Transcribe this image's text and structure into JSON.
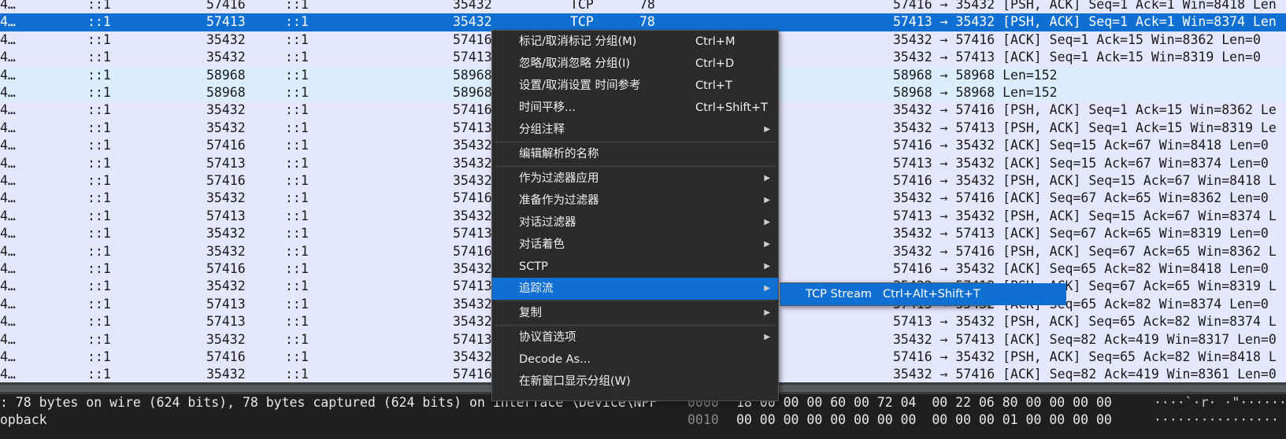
{
  "packet_rows": [
    {
      "no": "4…",
      "src": "::1",
      "sport": "57416",
      "dst": "::1",
      "dport": "35432",
      "proto": "TCP",
      "len": "78",
      "info": "57416 → 35432 [PSH, ACK] Seq=1 Ack=1 Win=8418 Len"
    },
    {
      "no": "4…",
      "src": "::1",
      "sport": "57413",
      "dst": "::1",
      "dport": "35432",
      "proto": "TCP",
      "len": "78",
      "info": "57413 → 35432 [PSH, ACK] Seq=1 Ack=1 Win=8374 Len"
    },
    {
      "no": "4…",
      "src": "::1",
      "sport": "35432",
      "dst": "::1",
      "dport": "57416",
      "proto": "",
      "len": "",
      "info": "35432 → 57416 [ACK] Seq=1 Ack=15 Win=8362 Len=0"
    },
    {
      "no": "4…",
      "src": "::1",
      "sport": "35432",
      "dst": "::1",
      "dport": "57413",
      "proto": "",
      "len": "",
      "info": "35432 → 57413 [ACK] Seq=1 Ack=15 Win=8319 Len=0"
    },
    {
      "no": "4…",
      "src": "::1",
      "sport": "58968",
      "dst": "::1",
      "dport": "58968",
      "proto": "",
      "len": "",
      "info": "58968 → 58968 Len=152"
    },
    {
      "no": "4…",
      "src": "::1",
      "sport": "58968",
      "dst": "::1",
      "dport": "58968",
      "proto": "",
      "len": "",
      "info": "58968 → 58968 Len=152"
    },
    {
      "no": "4…",
      "src": "::1",
      "sport": "35432",
      "dst": "::1",
      "dport": "57416",
      "proto": "",
      "len": "",
      "info": "35432 → 57416 [PSH, ACK] Seq=1 Ack=15 Win=8362 Le"
    },
    {
      "no": "4…",
      "src": "::1",
      "sport": "35432",
      "dst": "::1",
      "dport": "57413",
      "proto": "",
      "len": "",
      "info": "35432 → 57413 [PSH, ACK] Seq=1 Ack=15 Win=8319 Le"
    },
    {
      "no": "4…",
      "src": "::1",
      "sport": "57416",
      "dst": "::1",
      "dport": "35432",
      "proto": "",
      "len": "",
      "info": "57416 → 35432 [ACK] Seq=15 Ack=67 Win=8418 Len=0"
    },
    {
      "no": "4…",
      "src": "::1",
      "sport": "57413",
      "dst": "::1",
      "dport": "35432",
      "proto": "",
      "len": "",
      "info": "57413 → 35432 [ACK] Seq=15 Ack=67 Win=8374 Len=0"
    },
    {
      "no": "4…",
      "src": "::1",
      "sport": "57416",
      "dst": "::1",
      "dport": "35432",
      "proto": "",
      "len": "",
      "info": "57416 → 35432 [PSH, ACK] Seq=15 Ack=67 Win=8418 L"
    },
    {
      "no": "4…",
      "src": "::1",
      "sport": "35432",
      "dst": "::1",
      "dport": "57416",
      "proto": "",
      "len": "",
      "info": "35432 → 57416 [ACK] Seq=67 Ack=65 Win=8362 Len=0"
    },
    {
      "no": "4…",
      "src": "::1",
      "sport": "57413",
      "dst": "::1",
      "dport": "35432",
      "proto": "",
      "len": "",
      "info": "57413 → 35432 [PSH, ACK] Seq=15 Ack=67 Win=8374 L"
    },
    {
      "no": "4…",
      "src": "::1",
      "sport": "35432",
      "dst": "::1",
      "dport": "57413",
      "proto": "",
      "len": "",
      "info": "35432 → 57413 [ACK] Seq=67 Ack=65 Win=8319 Len=0"
    },
    {
      "no": "4…",
      "src": "::1",
      "sport": "35432",
      "dst": "::1",
      "dport": "57416",
      "proto": "",
      "len": "",
      "info": "35432 → 57416 [PSH, ACK] Seq=67 Ack=65 Win=8362 L"
    },
    {
      "no": "4…",
      "src": "::1",
      "sport": "57416",
      "dst": "::1",
      "dport": "35432",
      "proto": "",
      "len": "",
      "info": "57416 → 35432 [ACK] Seq=65 Ack=82 Win=8418 Len=0"
    },
    {
      "no": "4…",
      "src": "::1",
      "sport": "35432",
      "dst": "::1",
      "dport": "57413",
      "proto": "",
      "len": "",
      "info": "35432 → 57413 [PSH, ACK] Seq=67 Ack=65 Win=8319 L"
    },
    {
      "no": "4…",
      "src": "::1",
      "sport": "57413",
      "dst": "::1",
      "dport": "35432",
      "proto": "",
      "len": "",
      "info": "57413 → 35432 [ACK] Seq=65 Ack=82 Win=8374 Len=0"
    },
    {
      "no": "4…",
      "src": "::1",
      "sport": "57413",
      "dst": "::1",
      "dport": "35432",
      "proto": "",
      "len": "",
      "info": "57413 → 35432 [PSH, ACK] Seq=65 Ack=82 Win=8374 L"
    },
    {
      "no": "4…",
      "src": "::1",
      "sport": "35432",
      "dst": "::1",
      "dport": "57413",
      "proto": "",
      "len": "",
      "info": "35432 → 57413 [ACK] Seq=82 Ack=419 Win=8317 Len=0"
    },
    {
      "no": "4…",
      "src": "::1",
      "sport": "57416",
      "dst": "::1",
      "dport": "35432",
      "proto": "",
      "len": "",
      "info": "57416 → 35432 [PSH, ACK] Seq=65 Ack=82 Win=8418 L"
    },
    {
      "no": "4…",
      "src": "::1",
      "sport": "35432",
      "dst": "::1",
      "dport": "57416",
      "proto": "",
      "len": "",
      "info": "35432 → 57416 [ACK] Seq=82 Ack=419 Win=8361 Len=0"
    }
  ],
  "selected_row_index": 1,
  "alt_row_indices": [
    4,
    5
  ],
  "colors": {
    "row_bg": "#e7e6ff",
    "alt_row_bg": "#daeeff",
    "selected_bg": "#0f6fd3",
    "menu_bg": "#2b2b2b",
    "detail_bg": "#1f1f1f"
  },
  "detail": {
    "line1": ": 78 bytes on wire (624 bits), 78 bytes captured (624 bits) on interface \\Device\\NPF",
    "line2": "opback"
  },
  "hex": {
    "off1": "0000",
    "bytes1": "18 00 00 00 60 00 72 04  00 22 06 80 00 00 00 00",
    "ascii1": "····`·r· ·\"······",
    "off2": "0010",
    "bytes2": "00 00 00 00 00 00 00 00  00 00 00 01 00 00 00 00",
    "ascii2": "················"
  },
  "context_menu": {
    "items": [
      {
        "label": "标记/取消标记 分组(M)",
        "shortcut": "Ctrl+M",
        "submenu": false
      },
      {
        "label": "忽略/取消忽略 分组(I)",
        "shortcut": "Ctrl+D",
        "submenu": false
      },
      {
        "label": "设置/取消设置 时间参考",
        "shortcut": "Ctrl+T",
        "submenu": false
      },
      {
        "label": "时间平移...",
        "shortcut": "Ctrl+Shift+T",
        "submenu": false
      },
      {
        "label": "分组注释",
        "shortcut": "",
        "submenu": true
      },
      {
        "label": "编辑解析的名称",
        "shortcut": "",
        "submenu": false
      },
      {
        "label": "作为过滤器应用",
        "shortcut": "",
        "submenu": true
      },
      {
        "label": "准备作为过滤器",
        "shortcut": "",
        "submenu": true
      },
      {
        "label": "对话过滤器",
        "shortcut": "",
        "submenu": true
      },
      {
        "label": "对话着色",
        "shortcut": "",
        "submenu": true
      },
      {
        "label": "SCTP",
        "shortcut": "",
        "submenu": true
      },
      {
        "label": "追踪流",
        "shortcut": "",
        "submenu": true,
        "highlighted": true
      },
      {
        "label": "复制",
        "shortcut": "",
        "submenu": true
      },
      {
        "label": "协议首选项",
        "shortcut": "",
        "submenu": true
      },
      {
        "label": "Decode As...",
        "shortcut": "",
        "submenu": false
      },
      {
        "label": "在新窗口显示分组(W)",
        "shortcut": "",
        "submenu": false
      }
    ],
    "separators_after": [
      4,
      5,
      11,
      12
    ],
    "submenu_arrow": "▶"
  },
  "submenu": {
    "label": "TCP Stream",
    "shortcut": "Ctrl+Alt+Shift+T"
  }
}
